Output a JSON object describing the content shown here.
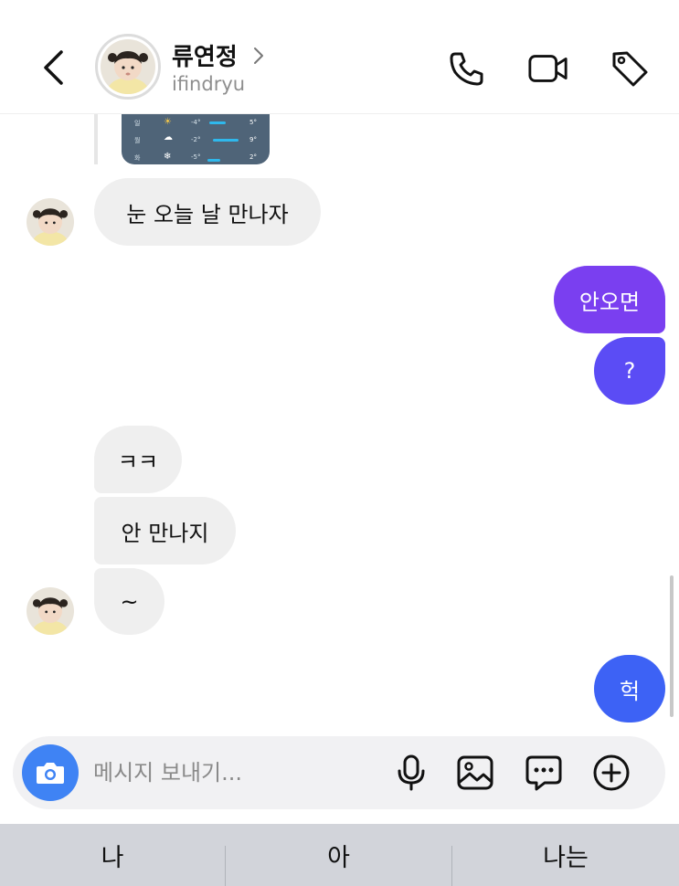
{
  "header": {
    "name": "류연정",
    "handle": "ifindryu",
    "icons": [
      "back-chevron-icon",
      "phone-icon",
      "video-icon",
      "tag-icon"
    ]
  },
  "messages": [
    {
      "side": "in",
      "text": "눈 오늘 날 만나자"
    },
    {
      "side": "out",
      "text": "안오면"
    },
    {
      "side": "out",
      "text": "?"
    },
    {
      "side": "in",
      "text": "ㅋㅋ"
    },
    {
      "side": "in",
      "text": "안 만나지"
    },
    {
      "side": "in",
      "text": "~"
    },
    {
      "side": "out",
      "text": "헉"
    }
  ],
  "shared_image": {
    "rows": [
      {
        "day": "일",
        "icon": "☀",
        "low": "-4°",
        "high": "5°"
      },
      {
        "day": "월",
        "icon": "☁",
        "low": "-2°",
        "high": "9°"
      },
      {
        "day": "화",
        "icon": "❄",
        "low": "-5°",
        "high": "2°"
      }
    ]
  },
  "composer": {
    "placeholder": "메시지 보내기...",
    "icons": [
      "camera-icon",
      "microphone-icon",
      "gallery-icon",
      "sticker-chat-icon",
      "plus-circle-icon"
    ]
  },
  "keyboard": {
    "suggestions": [
      "나",
      "아",
      "나는"
    ]
  },
  "colors": {
    "bubble_out_top": "#7a3ff0",
    "bubble_out_mid": "#5b4cf5",
    "bubble_out_bottom": "#3d62f5",
    "bubble_in": "#efefef",
    "camera": "#3f83f4"
  }
}
